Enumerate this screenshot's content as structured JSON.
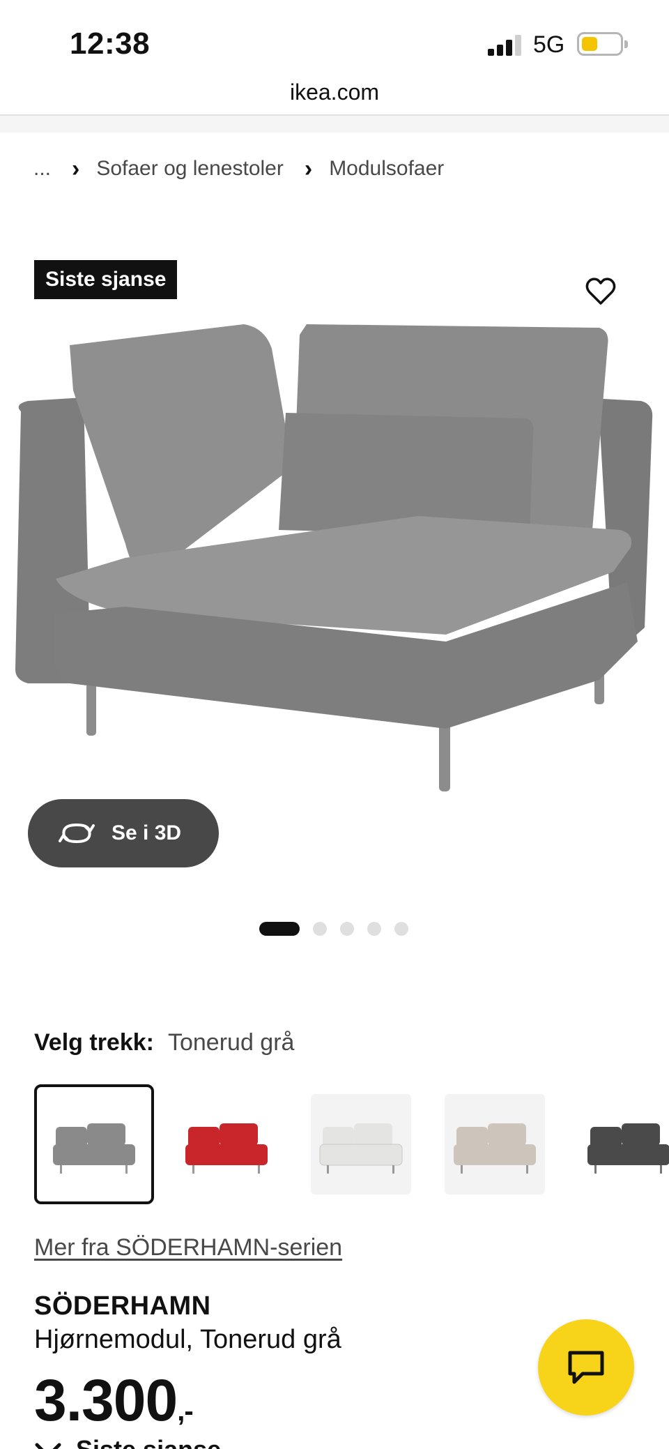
{
  "status_bar": {
    "time": "12:38",
    "network": "5G",
    "battery_color": "#f5c400"
  },
  "browser": {
    "url": "ikea.com"
  },
  "breadcrumb": {
    "ellipsis": "...",
    "items": [
      "Sofaer og lenestoler",
      "Modulsofaer"
    ]
  },
  "product_media": {
    "badge": "Siste sjanse",
    "favorite_icon": "heart-icon",
    "view_3d_label": "Se i 3D",
    "carousel_total": 5,
    "carousel_active_index": 0
  },
  "fabric": {
    "label": "Velg trekk:",
    "selected": "Tonerud grå",
    "swatch_colors": [
      "#8a8a8a",
      "#c9262c",
      "#e4e4e2",
      "#cdc5bb",
      "#4a4a4a"
    ],
    "selected_index": 0
  },
  "series_link": "Mer fra SÖDERHAMN-serien",
  "product": {
    "name": "SÖDERHAMN",
    "description": "Hjørnemodul, Tonerud grå",
    "price": "3.300",
    "price_suffix": ",-",
    "availability": "Siste sjanse"
  },
  "colors": {
    "brand_yellow": "#f7d31a",
    "badge_bg": "#111111",
    "button_dark": "#484848"
  }
}
